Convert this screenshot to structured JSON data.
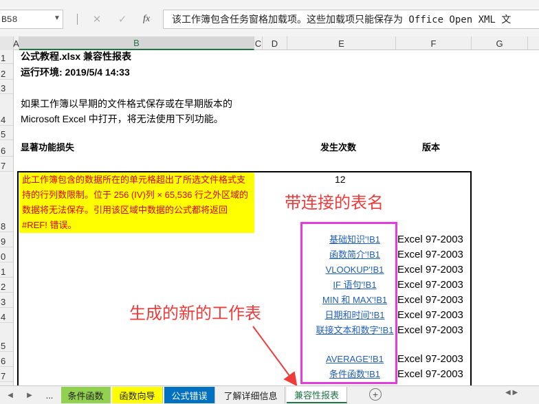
{
  "formula_bar": {
    "name_box": "B58",
    "cancel_glyph": "✕",
    "enter_glyph": "✓",
    "fx_label": "fx",
    "formula": "该工作簿包含任务窗格加载项。这些加载项只能保存为 Office Open XML 文"
  },
  "columns": [
    "A",
    "B",
    "C",
    "D",
    "E",
    "F",
    "G"
  ],
  "rows": [
    "1",
    "2",
    "3",
    "4",
    "5",
    "6",
    "7",
    "8",
    "9",
    "0",
    "1",
    "2",
    "3",
    "4",
    "5",
    "6",
    "7"
  ],
  "report": {
    "title": "公式教程.xlsx 兼容性报表",
    "run_env": "运行环境: 2019/5/4 14:33",
    "intro_line1": "如果工作簿以早期的文件格式保存或在早期版本的",
    "intro_line2": "Microsoft Excel 中打开，将无法使用下列功能。",
    "col_feature": "显著功能损失",
    "col_count": "发生次数",
    "col_version": "版本",
    "issue_text": "此工作簿包含的数据所在的单元格超出了所选文件格式支持的行列数限制。位于 256 (IV)列 × 65,536 行之外区域的数据将无法保存。引用该区域中数据的公式都将返回 #REF! 错误。",
    "issue_count": "12",
    "links": [
      {
        "text": "基础知识'!B1",
        "version": "Excel 97-2003"
      },
      {
        "text": "函数简介'!B1",
        "version": "Excel 97-2003"
      },
      {
        "text": "VLOOKUP'!B1",
        "version": "Excel 97-2003"
      },
      {
        "text": "IF 语句'!B1",
        "version": "Excel 97-2003"
      },
      {
        "text": "MIN 和 MAX'!B1",
        "version": "Excel 97-2003"
      },
      {
        "text": "日期和时间'!B1",
        "version": "Excel 97-2003"
      },
      {
        "text": "联接文本和数字'!B1",
        "version": "Excel 97-2003"
      },
      {
        "text": "AVERAGE'!B1",
        "version": "Excel 97-2003"
      },
      {
        "text": "条件函数'!B1",
        "version": "Excel 97-2003"
      }
    ]
  },
  "annotations": {
    "linked_sheet_names": "带连接的表名",
    "new_worksheet": "生成的新的工作表"
  },
  "tabs": {
    "ellipsis": "...",
    "items": [
      {
        "label": "条件函数",
        "color": "#92d050"
      },
      {
        "label": "函数向导",
        "color": "#ffff00"
      },
      {
        "label": "公式错误",
        "color": "#0070c0"
      },
      {
        "label": "了解详细信息",
        "color": "#f0f0f0"
      },
      {
        "label": "兼容性报表",
        "color": "#ffffff"
      }
    ],
    "add_glyph": "+"
  },
  "colors": {
    "accent": "#217346",
    "warning_fill": "#ffff00",
    "warning_text": "#e00000",
    "annotation": "#ee3b3b",
    "highlight_box": "#e53ce0",
    "link": "#1f5fb8"
  }
}
